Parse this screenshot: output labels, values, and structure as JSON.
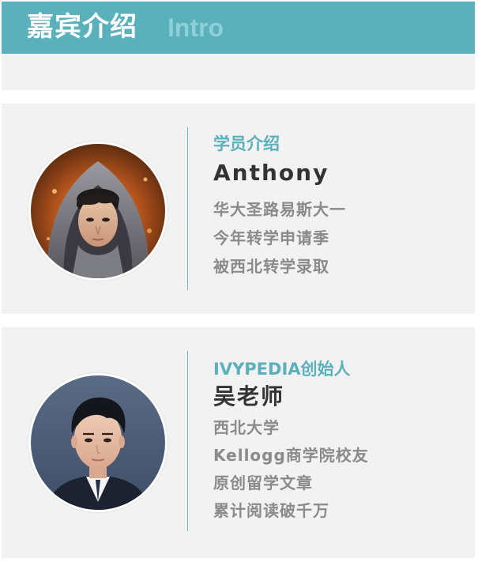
{
  "header": {
    "title": "嘉宾介绍",
    "subtitle": "Intro"
  },
  "guests": [
    {
      "role": "学员介绍",
      "name": "Anthony",
      "lines": [
        "华大圣路易斯大一",
        "今年转学申请季",
        "被西北转学录取"
      ]
    },
    {
      "role": "IVYPEDIA创始人",
      "name": "吴老师",
      "lines": [
        "西北大学",
        "Kellogg商学院校友",
        "原创留学文章",
        "累计阅读破千万"
      ]
    }
  ],
  "colors": {
    "accent": "#5ab0bb",
    "accent_light": "#8fd0d8",
    "card_bg": "#f2f2f2",
    "name_text": "#333333",
    "desc_text": "#8a8a8a"
  }
}
